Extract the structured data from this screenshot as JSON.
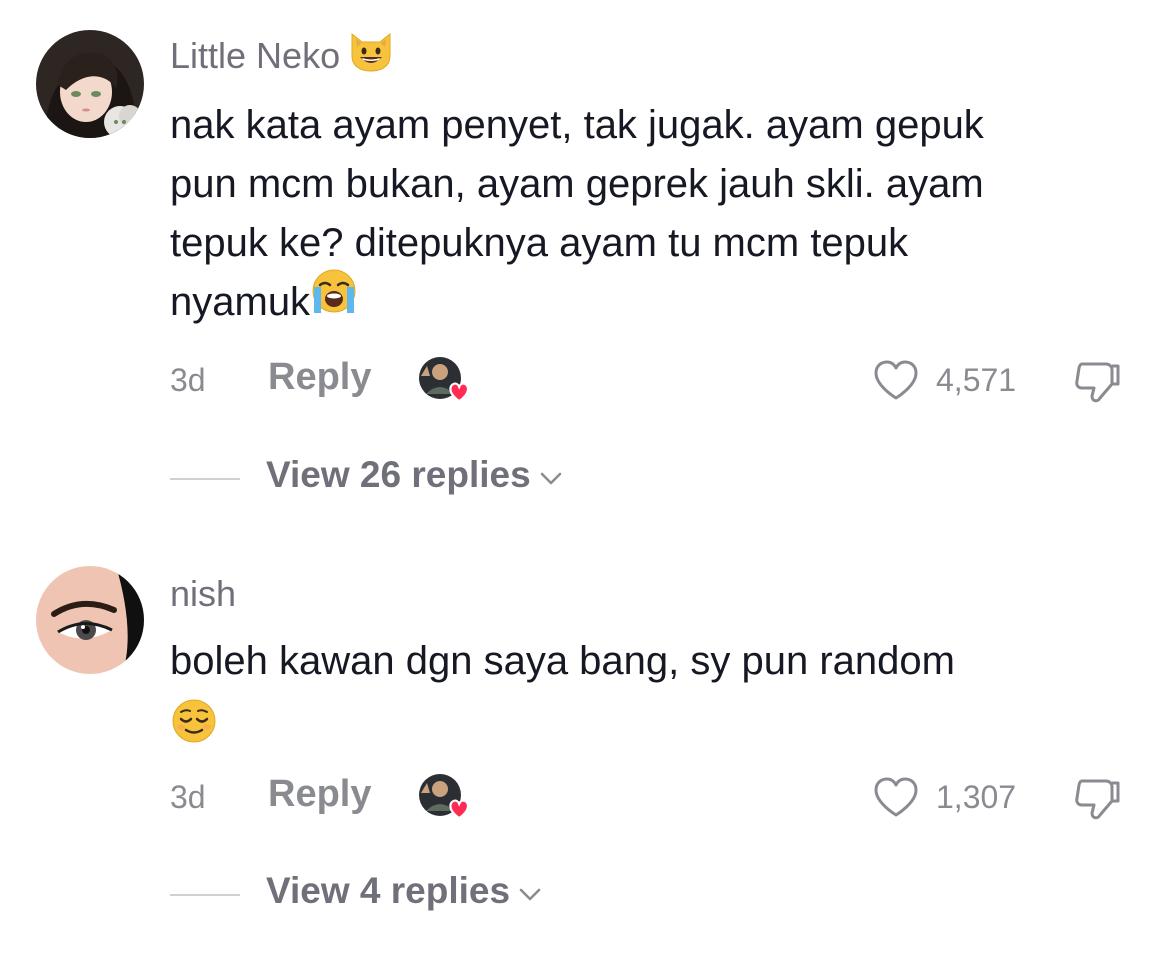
{
  "comments": [
    {
      "username": "Little Neko",
      "username_emoji": "grinning-cat-emoji",
      "text_lines": [
        "nak kata ayam penyet, tak jugak. ayam gepuk",
        "pun mcm bukan, ayam geprek jauh skli. ayam",
        "tepuk ke? ditepuknya ayam tu mcm tepuk",
        "nyamuk"
      ],
      "trailing_emoji": "loudly-crying-face-emoji",
      "time": "3d",
      "reply_label": "Reply",
      "likes": "4,571",
      "view_replies_label": "View 26 replies"
    },
    {
      "username": "nish",
      "text_lines": [
        "boleh kawan dgn saya bang, sy pun random"
      ],
      "trailing_emoji": "relieved-face-emoji",
      "time": "3d",
      "reply_label": "Reply",
      "likes": "1,307",
      "view_replies_label": "View 4 replies"
    }
  ],
  "colors": {
    "text_primary": "#161823",
    "text_secondary": "#8a8b91",
    "username": "#6f7079",
    "heart_badge": "#fe2c55"
  },
  "icons": {
    "like": "heart-outline-icon",
    "dislike": "thumbs-down-icon",
    "expand": "chevron-down-icon",
    "creator_liked": "creator-liked-badge-icon"
  }
}
